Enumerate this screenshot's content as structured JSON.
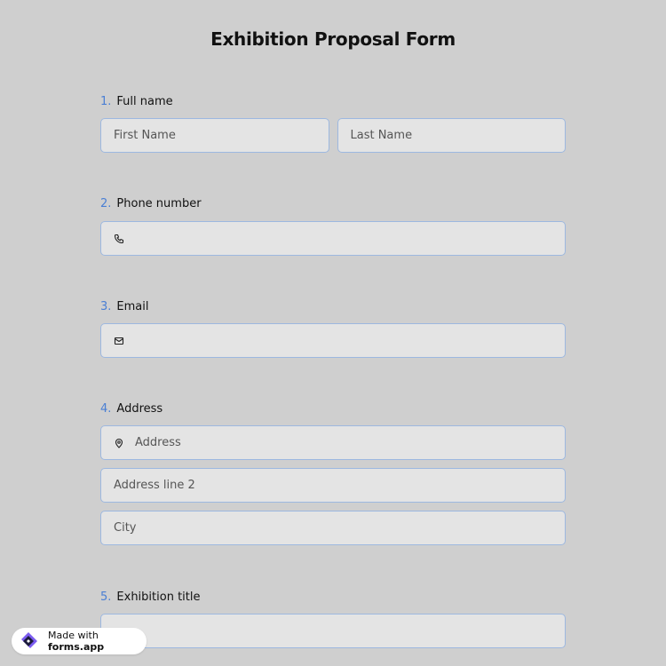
{
  "form": {
    "title": "Exhibition Proposal Form",
    "questions": [
      {
        "num": "1.",
        "label": "Full name",
        "first_placeholder": "First Name",
        "last_placeholder": "Last Name"
      },
      {
        "num": "2.",
        "label": "Phone number",
        "value": "",
        "icon": "phone-icon"
      },
      {
        "num": "3.",
        "label": "Email",
        "value": "",
        "icon": "mail-icon"
      },
      {
        "num": "4.",
        "label": "Address",
        "address_placeholder": "Address",
        "line2_placeholder": "Address line 2",
        "city_placeholder": "City",
        "icon": "location-pin-icon"
      },
      {
        "num": "5.",
        "label": "Exhibition title",
        "value": "",
        "icon": "text-icon"
      }
    ]
  },
  "badge": {
    "prefix": "Made with",
    "brand": "forms.app"
  },
  "colors": {
    "background": "#cfcfcf",
    "field_bg": "#e4e4e4",
    "field_border": "#9db8e0",
    "number_accent": "#4a7fd4",
    "logo_purple": "#7b5cf0"
  }
}
